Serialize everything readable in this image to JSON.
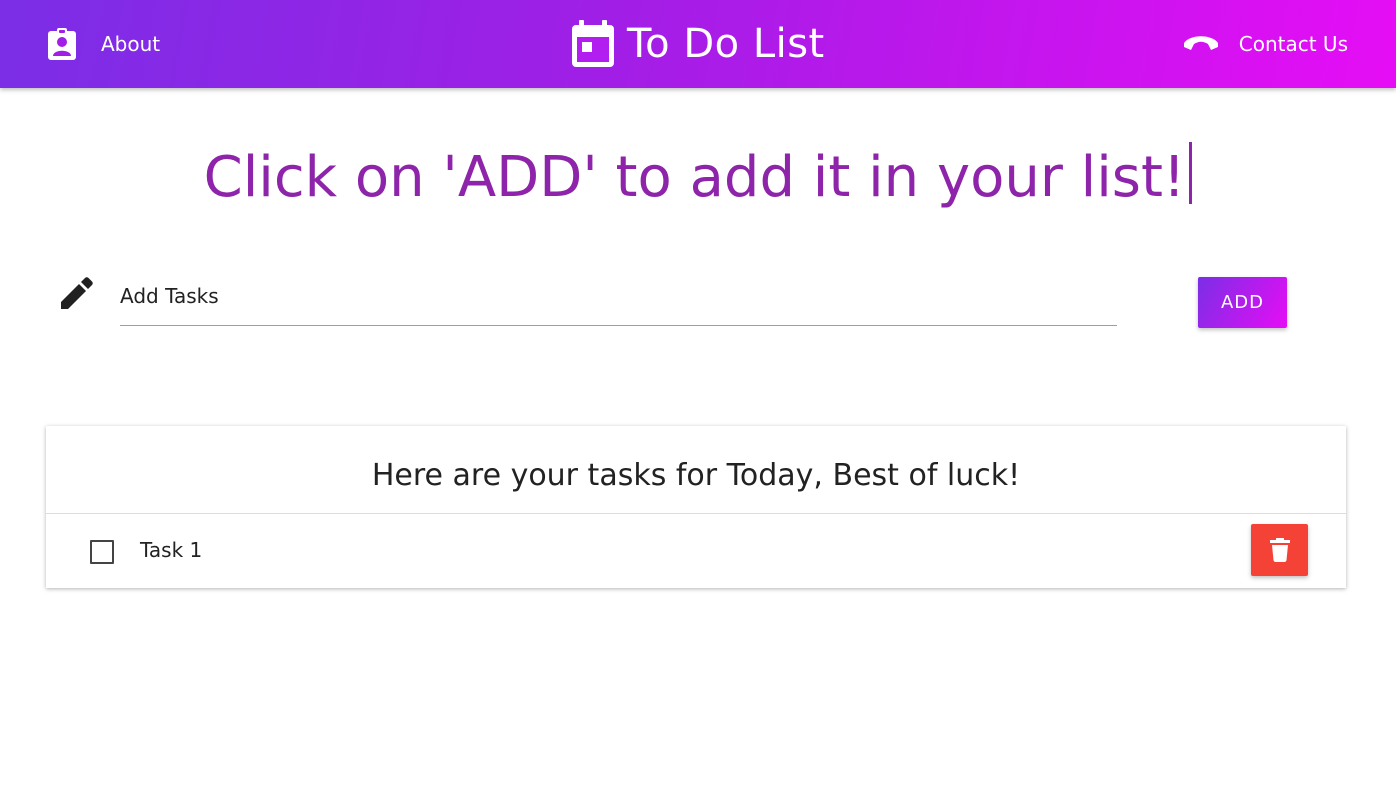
{
  "navbar": {
    "about_label": "About",
    "about_icon": "assignment-ind-icon",
    "brand_title": "To Do List",
    "brand_icon": "calendar-today-icon",
    "contact_label": "Contact Us",
    "contact_icon": "call-end-icon",
    "gradient_start": "#7b2ee6",
    "gradient_end": "#e60df5"
  },
  "headline": {
    "text": "Click on 'ADD' to add it in your list!",
    "color": "#8e24aa"
  },
  "task_form": {
    "icon": "pencil-icon",
    "input_placeholder": "Add Tasks",
    "input_value": "",
    "add_label": "ADD"
  },
  "task_list": {
    "header": "Here are your tasks for Today, Best of luck!",
    "items": [
      {
        "text": "Task 1",
        "checked": false,
        "delete_icon": "trash-icon",
        "delete_color": "#f44336"
      }
    ]
  }
}
